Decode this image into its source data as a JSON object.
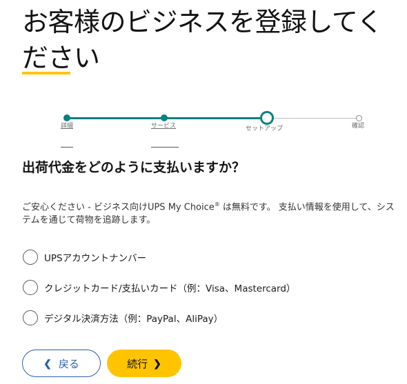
{
  "page": {
    "title": "お客様のビジネスを登録してください",
    "heading": "出荷代金をどのように支払いますか？",
    "description_pre": "ご安心ください - ビジネス向けUPS My Choice",
    "description_reg": "®",
    "description_post": " は無料です。 支払い情報を使用して、システムを通じて荷物を追跡します。"
  },
  "stepper": {
    "steps": [
      {
        "label": "詳細",
        "state": "done"
      },
      {
        "label": "サービス",
        "state": "done"
      },
      {
        "label": "セットアップ",
        "state": "current"
      },
      {
        "label": "確認",
        "state": "todo"
      }
    ],
    "colors": {
      "done": "#0a8080",
      "todo": "#bdbdbd"
    }
  },
  "payment_options": [
    {
      "label": "UPSアカウントナンバー",
      "selected": false
    },
    {
      "label": "クレジットカード/支払いカード（例：Visa、Mastercard）",
      "selected": false
    },
    {
      "label": "デジタル決済方法（例：PayPal、AliPay）",
      "selected": false
    }
  ],
  "buttons": {
    "back_label": "戻る",
    "back_icon": "chevron-left-icon",
    "next_label": "続行",
    "next_icon": "chevron-right-icon"
  },
  "colors": {
    "accent_yellow": "#ffc400",
    "teal": "#0a8080",
    "link_blue": "#2a5ea8"
  }
}
